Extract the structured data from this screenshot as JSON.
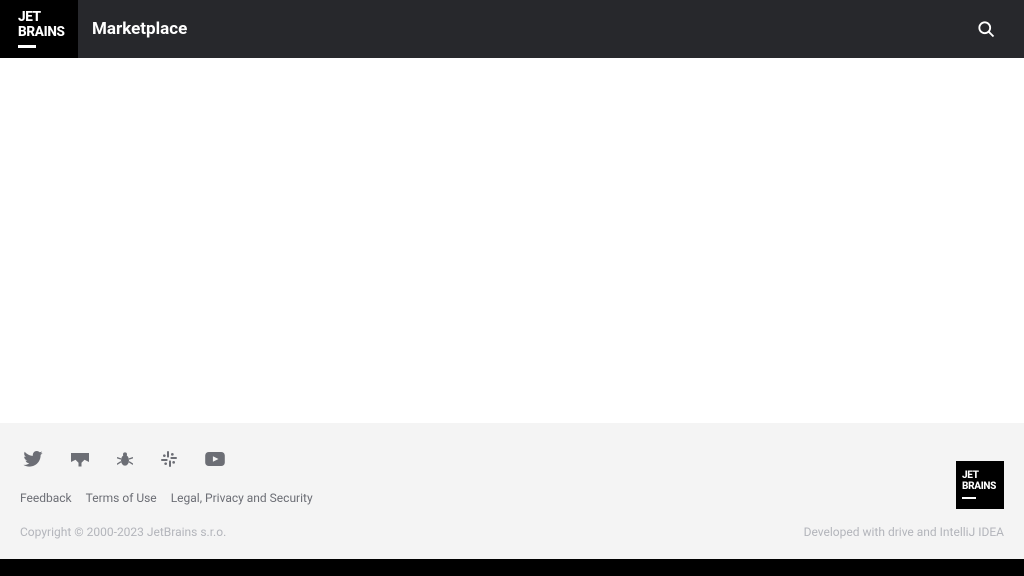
{
  "header": {
    "logo_line1": "JET",
    "logo_line2": "BRAINS",
    "title": "Marketplace"
  },
  "footer": {
    "links": {
      "feedback": "Feedback",
      "terms": "Terms of Use",
      "legal": "Legal, Privacy and Security"
    },
    "copyright": "Copyright © 2000-2023 JetBrains s.r.o.",
    "tagline": "Developed with drive and IntelliJ IDEA",
    "logo_line1": "JET",
    "logo_line2": "BRAINS"
  }
}
